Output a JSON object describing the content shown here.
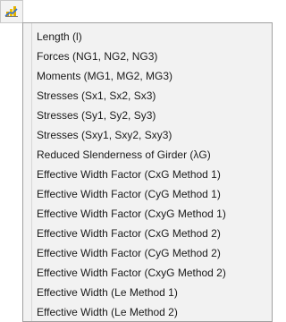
{
  "toolbar": {
    "button_icon": "chart-results-icon"
  },
  "menu": {
    "items": [
      {
        "label": "Length (l)"
      },
      {
        "label": "Forces (NG1, NG2, NG3)"
      },
      {
        "label": "Moments (MG1, MG2, MG3)"
      },
      {
        "label": "Stresses (Sx1, Sx2, Sx3)"
      },
      {
        "label": "Stresses (Sy1, Sy2, Sy3)"
      },
      {
        "label": "Stresses (Sxy1, Sxy2, Sxy3)"
      },
      {
        "label": "Reduced Slenderness of Girder (λG)"
      },
      {
        "label": "Effective Width Factor (CxG Method 1)"
      },
      {
        "label": "Effective Width Factor (CyG Method 1)"
      },
      {
        "label": "Effective Width Factor (CxyG Method 1)"
      },
      {
        "label": "Effective Width Factor (CxG Method 2)"
      },
      {
        "label": "Effective Width Factor (CyG Method 2)"
      },
      {
        "label": "Effective Width Factor (CxyG Method 2)"
      },
      {
        "label": "Effective Width (Le Method 1)"
      },
      {
        "label": "Effective Width (Le Method 2)"
      }
    ]
  }
}
